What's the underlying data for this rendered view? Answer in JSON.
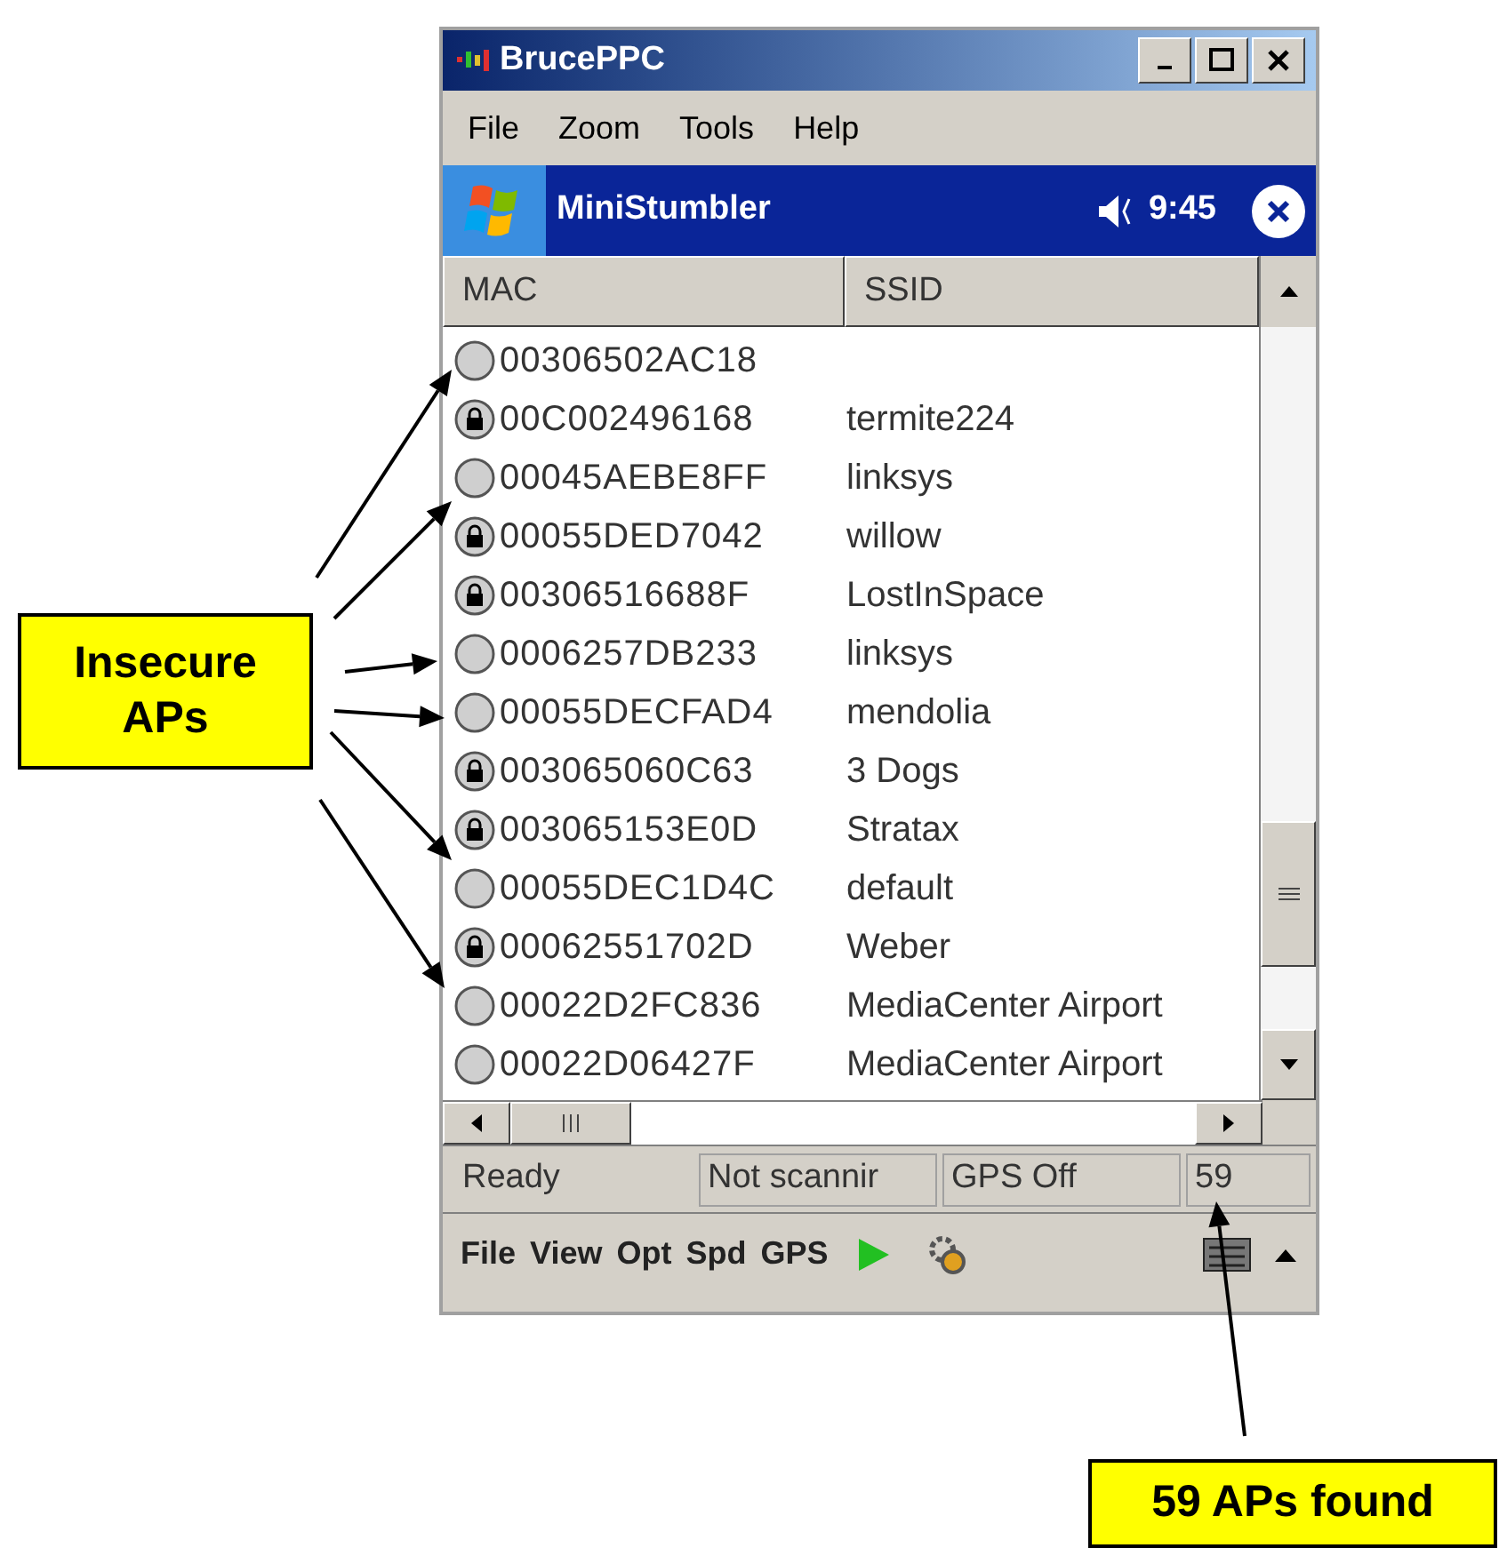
{
  "window": {
    "title": "BrucePPC"
  },
  "menu": [
    "File",
    "Zoom",
    "Tools",
    "Help"
  ],
  "app_bar": {
    "title": "MiniStumbler",
    "time": "9:45"
  },
  "columns": [
    "MAC",
    "SSID"
  ],
  "rows": [
    {
      "mac": "00306502AC18",
      "secure": false
    },
    {
      "mac": "00C002496168",
      "ssid": "termite224",
      "secure": true
    },
    {
      "mac": "00045AEBE8FF",
      "ssid": "linksys",
      "secure": false
    },
    {
      "mac": "00055DED7042",
      "ssid": "willow",
      "secure": true
    },
    {
      "mac": "00306516688F",
      "ssid": "LostInSpace",
      "secure": true
    },
    {
      "mac": "0006257DB233",
      "ssid": "linksys",
      "secure": false
    },
    {
      "mac": "00055DECFAD4",
      "ssid": "mendolia",
      "secure": false
    },
    {
      "mac": "003065060C63",
      "ssid": "3 Dogs",
      "secure": true
    },
    {
      "mac": "003065153E0D",
      "ssid": "Stratax",
      "secure": true
    },
    {
      "mac": "00055DEC1D4C",
      "ssid": "default",
      "secure": false
    },
    {
      "mac": "00062551702D",
      "ssid": "Weber",
      "secure": true
    },
    {
      "mac": "00022D2FC836",
      "ssid": "MediaCenter Airport",
      "secure": false
    },
    {
      "mac": "00022D06427F",
      "ssid": "MediaCenter Airport",
      "secure": false
    }
  ],
  "status_bar": [
    "Ready",
    "Not scannir",
    "GPS Off",
    "59"
  ],
  "command_bar": [
    "File",
    "View",
    "Opt",
    "Spd",
    "GPS"
  ],
  "callouts": [
    {
      "text": "Insecure APs"
    },
    {
      "text": "59 APs found"
    }
  ]
}
